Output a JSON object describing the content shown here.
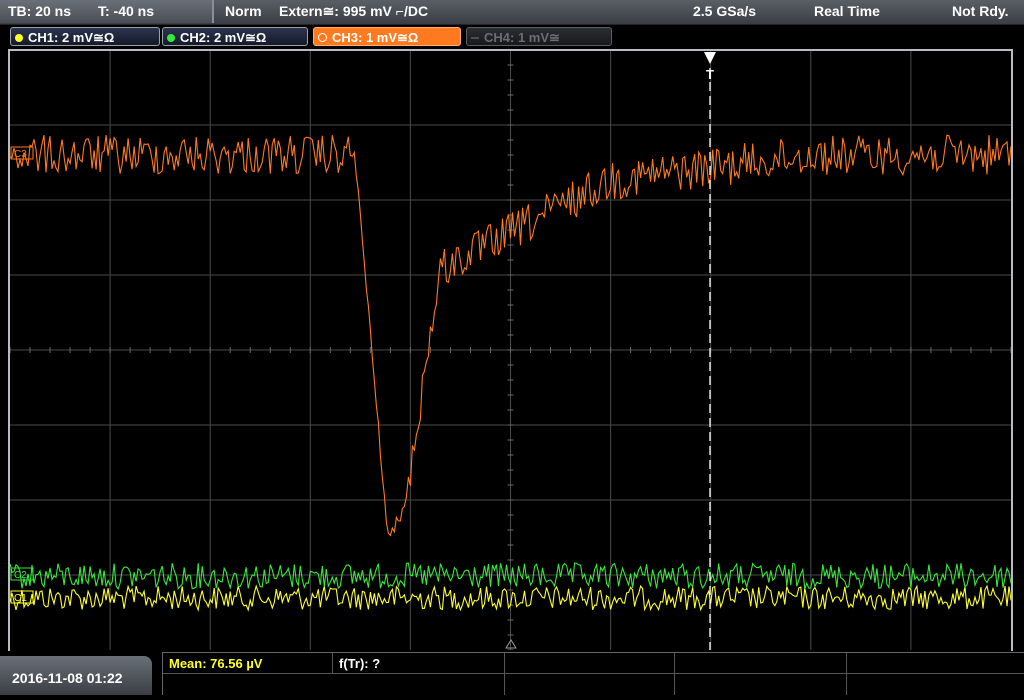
{
  "status_bar": {
    "timebase": "TB: 20 ns",
    "trigger_offset": "T: -40 ns",
    "acq_mode": "Norm",
    "trigger_source": "Extern≅: 995 mV ⌐/DC",
    "sample_rate": "2.5 GSa/s",
    "sampling": "Real Time",
    "trigger_state": "Not Rdy."
  },
  "channels": [
    {
      "label": "CH1: 2 mV≅Ω",
      "color": "#ffff2a",
      "state": "on"
    },
    {
      "label": "CH2: 2 mV≅Ω",
      "color": "#36e83a",
      "state": "on"
    },
    {
      "label": "CH3: 1 mV≅Ω",
      "color": "#ff7a1f",
      "state": "active"
    },
    {
      "label": "CH4: 1 mV≅",
      "color": "#6a6e74",
      "state": "off"
    }
  ],
  "markers": {
    "trigger_marker": "T",
    "ch3_ref": "C3",
    "ch2_ref": "C2",
    "ch1_ref": "C1"
  },
  "bottom": {
    "datetime": "2016-11-08 01:22",
    "measurement_mean": "Mean: 76.56 µV",
    "measurement_ftr": "f(Tr): ?"
  },
  "colors": {
    "ch1": "#ffff2a",
    "ch2": "#36e83a",
    "ch3": "#ff7a1f",
    "grid": "#4a4a4a",
    "trigger": "#ffffff"
  }
}
